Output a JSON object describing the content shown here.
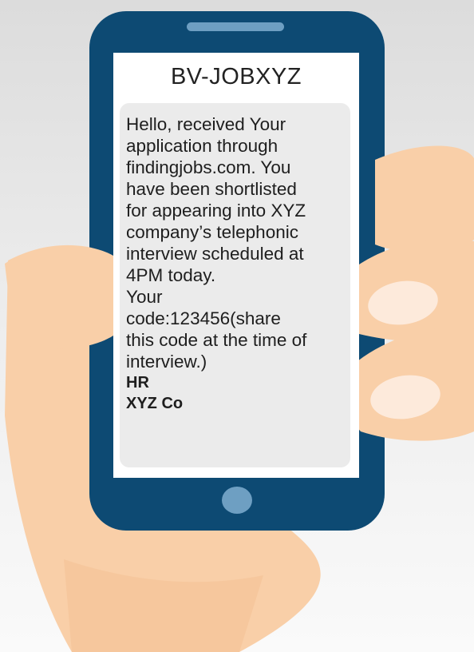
{
  "sender": "BV-JOBXYZ",
  "message": {
    "lines": [
      "Hello, received Your",
      "application through",
      "findingjobs.com. You",
      "have been shortlisted",
      "for appearing into XYZ",
      "company’s telephonic",
      "interview scheduled at",
      "4PM today.",
      "Your",
      "code:123456(share",
      "this code at the time of",
      "interview.)"
    ],
    "signature": [
      "HR",
      "XYZ Co"
    ]
  },
  "colors": {
    "phone_body": "#0d4a73",
    "skin": "#f9cfa8",
    "fingernail": "#fdeadb",
    "bubble": "#ebebeb",
    "home_button": "#6e9fc2"
  },
  "icons": [
    "phone-speaker-slot-icon",
    "home-button-icon",
    "hand-illustration"
  ]
}
